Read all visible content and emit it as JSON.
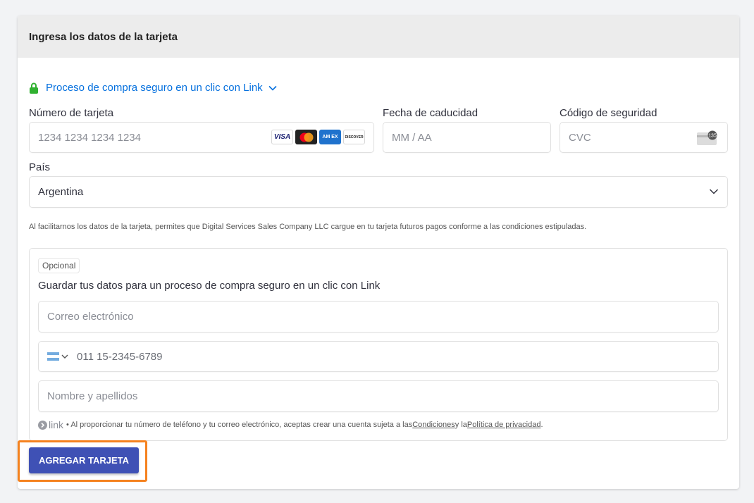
{
  "header": {
    "title": "Ingresa los datos de la tarjeta"
  },
  "link_promo": {
    "label": "Proceso de compra seguro en un clic con Link"
  },
  "card_number": {
    "label": "Número de tarjeta",
    "placeholder": "1234 1234 1234 1234"
  },
  "expiry": {
    "label": "Fecha de caducidad",
    "placeholder": "MM / AA"
  },
  "security_code": {
    "label": "Código de seguridad",
    "placeholder": "CVC",
    "icon_text": "135"
  },
  "brands": {
    "visa": "VISA",
    "amex": "AM EX",
    "discover": "DISCOVER"
  },
  "country": {
    "label": "País",
    "value": "Argentina"
  },
  "consent": "Al facilitarnos los datos de la tarjeta, permites que Digital Services Sales Company LLC cargue en tu tarjeta futuros pagos conforme a las condiciones estipuladas.",
  "link_section": {
    "optional_badge": "Opcional",
    "save_text": "Guardar tus datos para un proceso de compra seguro en un clic con Link",
    "email_placeholder": "Correo electrónico",
    "phone_placeholder": "011 15-2345-6789",
    "name_placeholder": "Nombre y apellidos",
    "link_logo": "link",
    "legal_prefix": " • Al proporcionar tu número de teléfono y tu correo electrónico, aceptas crear una cuenta sujeta a las ",
    "terms_link": "Condiciones",
    "legal_mid": " y la ",
    "privacy_link": "Política de privacidad",
    "legal_suffix": "."
  },
  "submit": {
    "label": "AGREGAR TARJETA"
  },
  "colors": {
    "accent": "#3f51b5",
    "link_blue": "#0570de",
    "highlight": "#f5821f",
    "lock_green": "#30b130"
  }
}
